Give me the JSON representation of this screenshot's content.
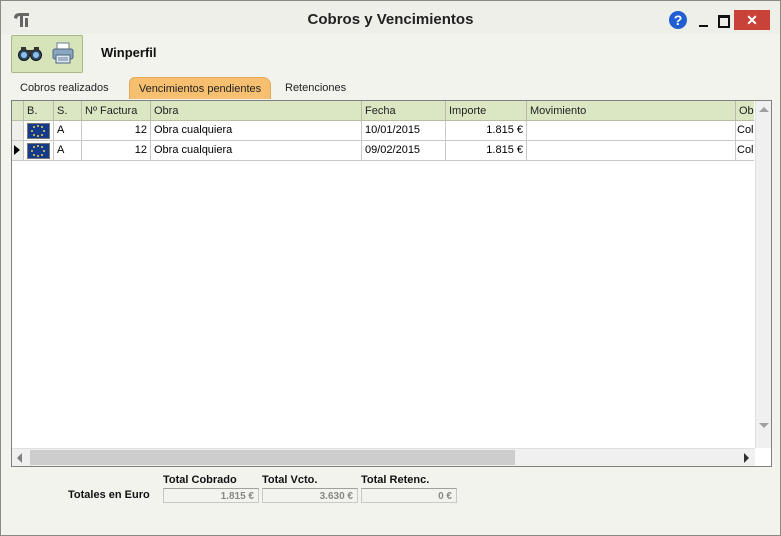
{
  "window": {
    "title": "Cobros y Vencimientos",
    "help_glyph": "?",
    "close_glyph": "✕",
    "accent_close": "#c8423a"
  },
  "toolbar": {
    "module_name": "Winperfil",
    "buttons": [
      {
        "icon": "binoculars-icon"
      },
      {
        "icon": "printer-icon"
      }
    ]
  },
  "tabs": [
    {
      "label": "Cobros realizados",
      "active": false
    },
    {
      "label": "Vencimientos pendientes",
      "active": true
    },
    {
      "label": "Retenciones",
      "active": false
    }
  ],
  "table": {
    "columns": [
      "B.",
      "S.",
      "Nº Factura",
      "Obra",
      "Fecha",
      "Importe",
      "Movimiento",
      "Ob"
    ],
    "rows": [
      {
        "flag": "eu-flag-icon",
        "serie": "A",
        "factura": "12",
        "obra": "Obra cualquiera",
        "fecha": "10/01/2015",
        "importe": "1.815 €",
        "movimiento": "",
        "ob": "Col"
      },
      {
        "flag": "eu-flag-icon",
        "serie": "A",
        "factura": "12",
        "obra": "Obra cualquiera",
        "fecha": "09/02/2015",
        "importe": "1.815 €",
        "movimiento": "",
        "ob": "Col",
        "current": true
      }
    ]
  },
  "totals": {
    "label": "Totales en Euro",
    "cobrado_header": "Total Cobrado",
    "vcto_header": "Total Vcto.",
    "retenc_header": "Total Retenc.",
    "cobrado_value": "1.815 €",
    "vcto_value": "3.630 €",
    "retenc_value": "0 €"
  }
}
